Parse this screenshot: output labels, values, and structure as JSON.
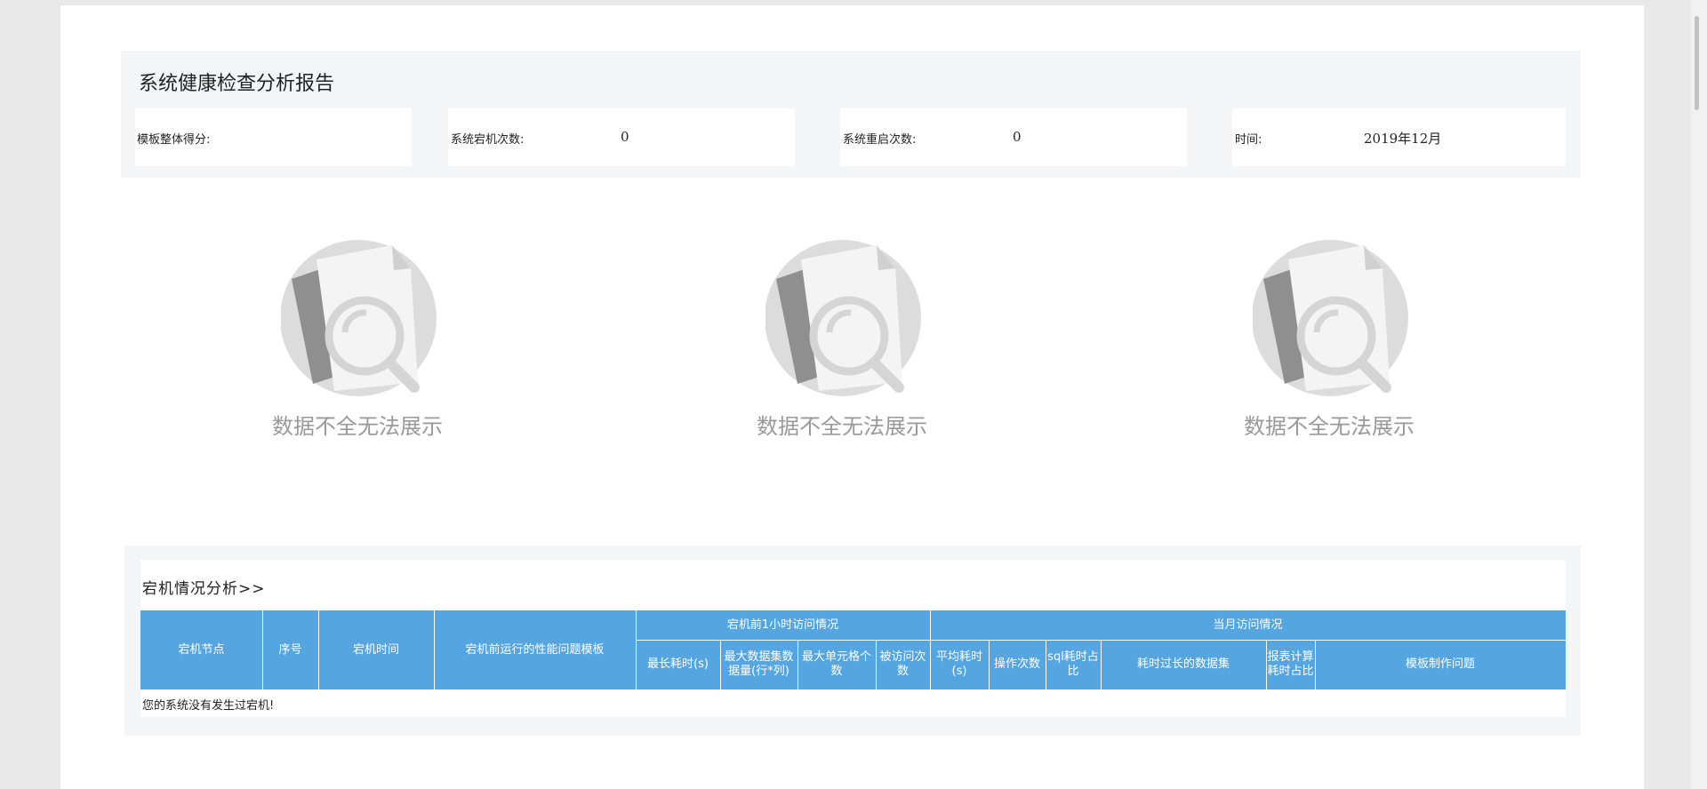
{
  "report": {
    "title": "系统健康检查分析报告"
  },
  "stats": [
    {
      "label": "模板整体得分:",
      "value": ""
    },
    {
      "label": "系统宕机次数:",
      "value": "0"
    },
    {
      "label": "系统重启次数:",
      "value": "0"
    },
    {
      "label": "时间:",
      "value": "2019年12月"
    }
  ],
  "placeholders": [
    {
      "text": "数据不全无法展示",
      "icon": "empty-document-search-icon"
    },
    {
      "text": "数据不全无法展示",
      "icon": "empty-document-search-icon"
    },
    {
      "text": "数据不全无法展示",
      "icon": "empty-document-search-icon"
    }
  ],
  "crash": {
    "title": "宕机情况分析>>",
    "group_headers": {
      "before_hour": "宕机前1小时访问情况",
      "month": "当月访问情况"
    },
    "columns": {
      "node": "宕机节点",
      "seq": "序号",
      "time": "宕机时间",
      "template": "宕机前运行的性能问题模板",
      "max_time": "最长耗时(s)",
      "max_rows": "最大数据集数据量(行*列)",
      "max_cells": "最大单元格个数",
      "visits": "被访问次数",
      "avg_time": "平均耗时(s)",
      "ops": "操作次数",
      "sql_ratio": "sql耗时占比",
      "slow_dataset": "耗时过长的数据集",
      "report_ratio": "报表计算耗时占比",
      "template_issue": "模板制作问题"
    },
    "empty_message": "您的系统没有发生过宕机!"
  },
  "colors": {
    "header_bg": "#55a6e0",
    "panel_bg": "#f4f5f7",
    "placeholder_text": "#999999"
  }
}
